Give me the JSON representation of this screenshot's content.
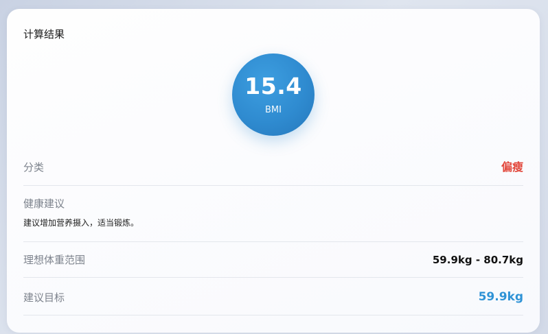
{
  "card": {
    "title": "计算结果"
  },
  "bmi": {
    "value": "15.4",
    "label": "BMI",
    "circle_color": "#2f8bd0"
  },
  "rows": {
    "category": {
      "label": "分类",
      "value": "偏瘦",
      "value_color": "#e2473b"
    },
    "advice": {
      "label": "健康建议",
      "text": "建议增加营养摄入，适当锻炼。"
    },
    "ideal_weight": {
      "label": "理想体重范围",
      "value": "59.9kg - 80.7kg"
    },
    "target": {
      "label": "建议目标",
      "value": "59.9kg",
      "value_color": "#2f93d6"
    }
  }
}
